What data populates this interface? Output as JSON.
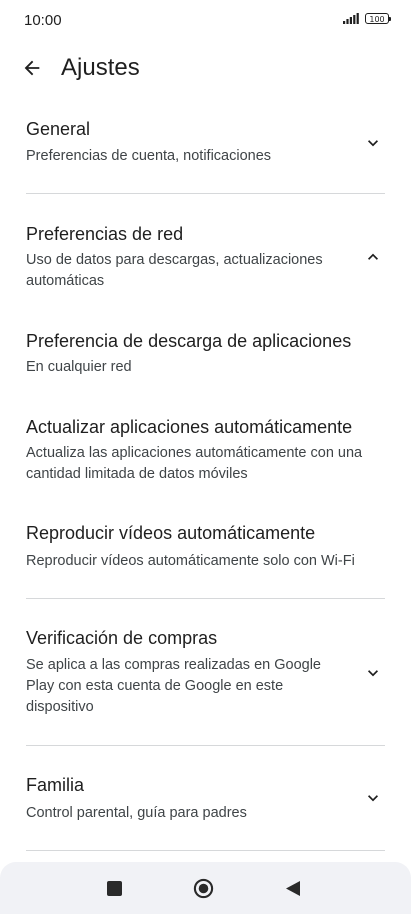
{
  "status_bar": {
    "time": "10:00",
    "battery": "100"
  },
  "app_bar": {
    "title": "Ajustes",
    "back_icon": "arrow-back-icon"
  },
  "sections": [
    {
      "title": "General",
      "subtitle": "Preferencias de cuenta, notificaciones",
      "expanded": false
    },
    {
      "title": "Preferencias de red",
      "subtitle": "Uso de datos para descargas, actualizaciones automáticas",
      "expanded": true,
      "items": [
        {
          "title": "Preferencia de descarga de aplicaciones",
          "subtitle": "En cualquier red"
        },
        {
          "title": "Actualizar aplicaciones automáticamente",
          "subtitle": "Actualiza las aplicaciones automáticamente con una cantidad limitada de datos móviles"
        },
        {
          "title": "Reproducir vídeos automáticamente",
          "subtitle": "Reproducir vídeos automáticamente solo con Wi-Fi"
        }
      ]
    },
    {
      "title": "Verificación de compras",
      "subtitle": "Se aplica a las compras realizadas en Google Play con esta cuenta de Google en este dispositivo",
      "expanded": false
    },
    {
      "title": "Familia",
      "subtitle": "Control parental, guía para padres",
      "expanded": false
    }
  ],
  "nav_bar": {
    "recents_icon": "square-recents-icon",
    "home_icon": "circle-home-icon",
    "back_icon": "triangle-back-icon"
  }
}
